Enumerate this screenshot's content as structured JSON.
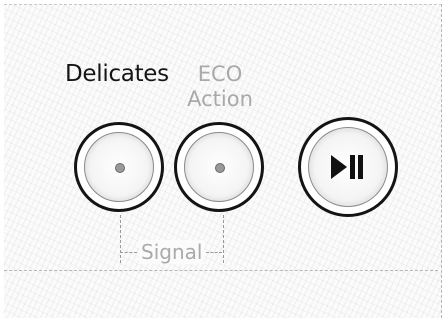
{
  "options": {
    "delicates_label": "Delicates",
    "eco_label_line1": "ECO",
    "eco_label_line2": "Action",
    "signal_label": "Signal"
  },
  "buttons": {
    "delicates_icon": "dot-icon",
    "eco_icon": "dot-icon",
    "start_pause_icon": "play-pause-icon"
  },
  "colors": {
    "active_text": "#151515",
    "inactive_text": "#a9a9a9",
    "button_ring": "#141414"
  }
}
